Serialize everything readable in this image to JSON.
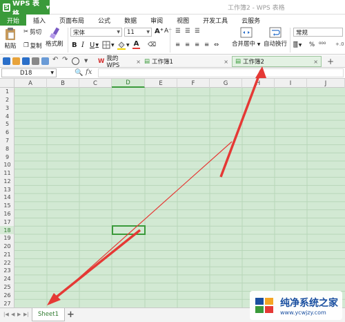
{
  "app": {
    "wps_button": "WPS 表格",
    "doc_title": "工作簿2 - WPS 表格"
  },
  "menu": [
    "开始",
    "插入",
    "页面布局",
    "公式",
    "数据",
    "审阅",
    "视图",
    "开发工具",
    "云服务"
  ],
  "ribbon": {
    "paste": "粘贴",
    "cut": "剪切",
    "copy": "复制",
    "format_painter": "格式刷",
    "font_name": "宋体",
    "font_size": "11",
    "bold": "B",
    "italic": "I",
    "underline": "U",
    "grow_font": "A⁺",
    "shrink_font": "A⁻",
    "merge_center": "合并居中",
    "wrap_text": "自动换行",
    "number_format": "常规",
    "percent": "%",
    "thousands": "⁰⁰⁰"
  },
  "quick_access": {
    "tabs": [
      {
        "label": "我的WPS",
        "active": false
      },
      {
        "label": "工作簿1",
        "active": false
      },
      {
        "label": "工作簿2",
        "active": true
      }
    ],
    "add": "+"
  },
  "formula_bar": {
    "name_box": "D18",
    "fx": "fx"
  },
  "grid": {
    "columns": [
      "A",
      "B",
      "C",
      "D",
      "E",
      "F",
      "G",
      "H",
      "I",
      "J"
    ],
    "rows": [
      "1",
      "2",
      "3",
      "4",
      "5",
      "6",
      "7",
      "8",
      "9",
      "10",
      "11",
      "12",
      "13",
      "14",
      "15",
      "16",
      "17",
      "18",
      "19",
      "20",
      "21",
      "22",
      "23",
      "24",
      "25",
      "26",
      "27"
    ],
    "selected_column": "D",
    "selected_row": "18",
    "fill_color": "#d2e9d3"
  },
  "sheet_tabs": {
    "tabs": [
      "Sheet1"
    ],
    "add": "+"
  },
  "annotations": {
    "arrow_color": "#e53935"
  },
  "watermark": {
    "title": "纯净系统之家",
    "url": "www.ycwjzy.com"
  }
}
